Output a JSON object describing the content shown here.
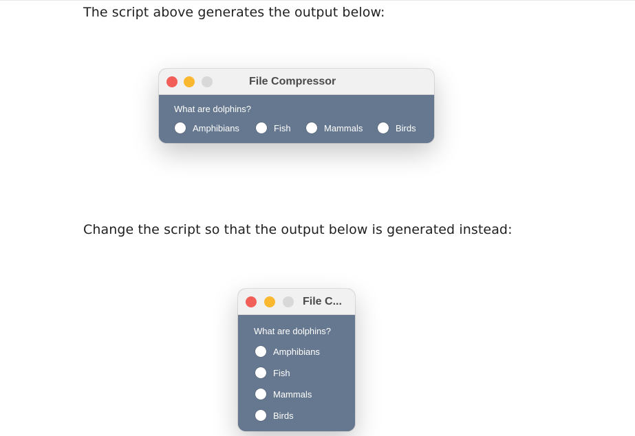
{
  "text": {
    "before": "The script above generates the output below:",
    "after": "Change the script so that the output below is generated instead:"
  },
  "window_current": {
    "title": "File Compressor",
    "question": "What are dolphins?",
    "options": [
      "Amphibians",
      "Fish",
      "Mammals",
      "Birds"
    ]
  },
  "window_desired": {
    "title": "File C...",
    "question": "What are dolphins?",
    "options": [
      "Amphibians",
      "Fish",
      "Mammals",
      "Birds"
    ]
  },
  "colors": {
    "window_background": "#667890",
    "titlebar_background": "#f1f1f1",
    "close_button": "#f25f58",
    "minimize_button": "#f9b82f",
    "zoom_button": "#d8d8d8"
  }
}
